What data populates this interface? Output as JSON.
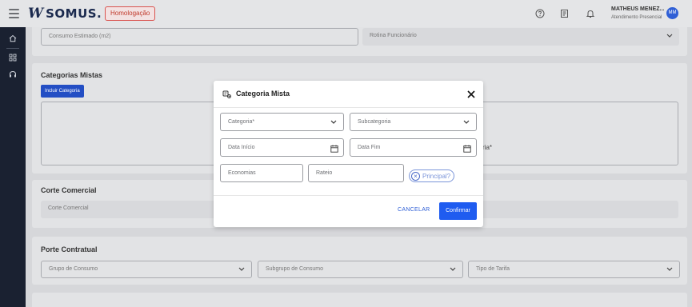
{
  "header": {
    "logo_mark": "W",
    "logo_text": "SOMUS.",
    "environment_badge": "Homologação",
    "user_name": "MATHEUS MENEZ...",
    "user_role": "Atendimento Presencial",
    "avatar_initials": "MM"
  },
  "background": {
    "consumo_estimado": "Consumo Estimado (m2)",
    "rotina_funcionario": "Rotina Funcionário",
    "categorias_mistas_title": "Categorias Mistas",
    "incluir_categoria": "Incluir Categoria",
    "partial_text": "ria*",
    "corte_comercial_title": "Corte Comercial",
    "corte_comercial_field": "Corte Comercial",
    "porte_contratual_title": "Porte Contratual",
    "grupo_consumo": "Grupo de Consumo",
    "subgrupo_consumo": "Subgrupo de Consumo",
    "tipo_tarifa": "Tipo de Tarifa"
  },
  "modal": {
    "title": "Categoria Mista",
    "categoria_placeholder": "Categoria*",
    "subcategoria_placeholder": "Subcategoria",
    "data_inicio_placeholder": "Data Início",
    "data_fim_placeholder": "Data Fim",
    "economias_placeholder": "Economias",
    "rateio_placeholder": "Rateio",
    "principal_label": "Principal?",
    "cancel_label": "CANCELAR",
    "confirm_label": "Confirmar"
  },
  "colors": {
    "primary": "#1f5cf0",
    "sidenav": "#1a2131",
    "badge": "#c0392b"
  },
  "icons": [
    "menu-icon",
    "help-icon",
    "notes-icon",
    "bell-icon",
    "home-icon",
    "grid-icon",
    "headset-icon",
    "category-icon",
    "close-icon",
    "calendar-icon",
    "chevron-down-icon"
  ]
}
